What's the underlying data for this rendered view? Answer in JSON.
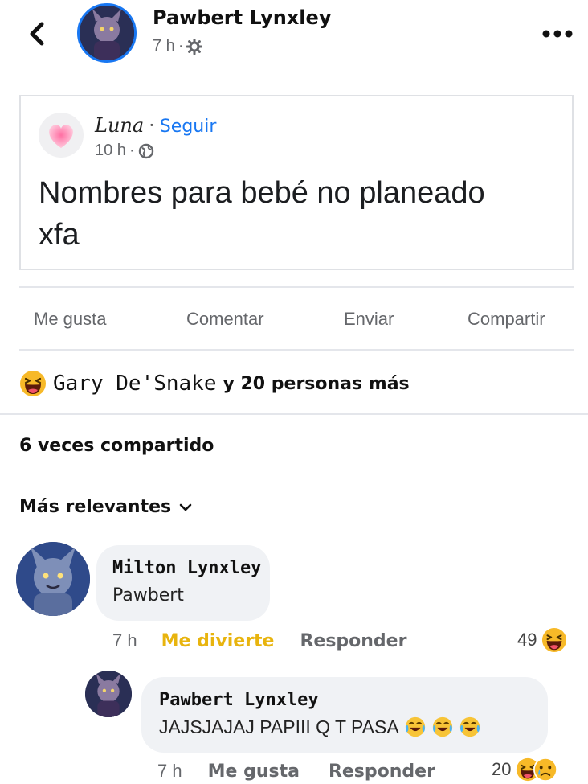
{
  "header": {
    "author": "Pawbert Lynxley",
    "time": "7 h",
    "separator": "·"
  },
  "shared_post": {
    "author": "Luna",
    "separator": "·",
    "follow": "Seguir",
    "time": "10 h",
    "meta_separator": "·",
    "text_line1": "Nombres para bebé no planeado",
    "text_line2": "xfa"
  },
  "actions": {
    "like": "Me gusta",
    "comment": "Comentar",
    "send": "Enviar",
    "share": "Compartir"
  },
  "reactions": {
    "names": "Gary De'Snake",
    "rest": "y 20 personas más"
  },
  "shares": "6 veces compartido",
  "sort": "Más relevantes",
  "comments": [
    {
      "author": "Milton Lynxley",
      "text": "Pawbert",
      "time": "7 h",
      "reaction_label": "Me divierte",
      "reply": "Responder",
      "count": "49"
    },
    {
      "author": "Pawbert Lynxley",
      "text": "JAJSJAJAJ PAPIII Q T PASA",
      "time": "7 h",
      "like": "Me gusta",
      "reply": "Responder",
      "count": "20"
    }
  ],
  "colors": {
    "accent": "#1877f2",
    "haha_yellow": "#f7b928",
    "reaction_text_yellow": "#e8b40e",
    "muted": "#65676b"
  }
}
